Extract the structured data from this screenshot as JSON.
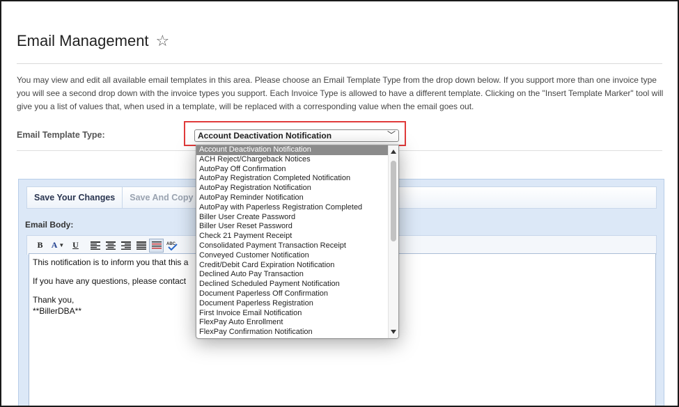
{
  "page": {
    "title": "Email Management",
    "favorite_icon": "star-outline-icon",
    "intro_text": "You may view and edit all available email templates in this area. Please choose an Email Template Type from the drop down below. If you support more than one invoice type you will see a second drop down with the invoice types you support. Each Invoice Type is allowed to have a different template. Clicking on the \"Insert Template Marker\" tool will give you a list of values that, when used in a template, will be replaced with a corresponding value when the email goes out."
  },
  "template_type": {
    "label": "Email Template Type:",
    "selected": "Account Deactivation Notification",
    "highlight_color": "#e03a3a",
    "options": [
      "Account Deactivation Notification",
      "ACH Reject/Chargeback Notices",
      "AutoPay Off Confirmation",
      "AutoPay Registration Completed Notification",
      "AutoPay Registration Notification",
      "AutoPay Reminder Notification",
      "AutoPay with Paperless Registration Completed",
      "Biller User Create Password",
      "Biller User Reset Password",
      "Check 21 Payment Receipt",
      "Consolidated Payment Transaction Receipt",
      "Conveyed Customer Notification",
      "Credit/Debit Card Expiration Notification",
      "Declined Auto Pay Transaction",
      "Declined Scheduled Payment Notification",
      "Document Paperless Off Confirmation",
      "Document Paperless Registration",
      "First Invoice Email Notification",
      "FlexPay Auto Enrollment",
      "FlexPay Confirmation Notification"
    ]
  },
  "editor": {
    "save_label": "Save Your Changes",
    "copy_label": "Save And Copy to A",
    "body_label": "Email Body:",
    "format_buttons": [
      "bold-icon",
      "font-color-icon",
      "underline-icon",
      "align-left-icon",
      "align-center-icon",
      "align-right-icon",
      "justify-icon",
      "insert-template-marker-icon",
      "spellcheck-icon"
    ],
    "body_lines": [
      "This notification is to inform you that this a",
      "If you have any questions, please contact",
      "Thank you,",
      "**BillerDBA**"
    ]
  },
  "colors": {
    "editor_panel_bg": "#dce8f7",
    "selected_option_bg": "#8b8b8b"
  }
}
